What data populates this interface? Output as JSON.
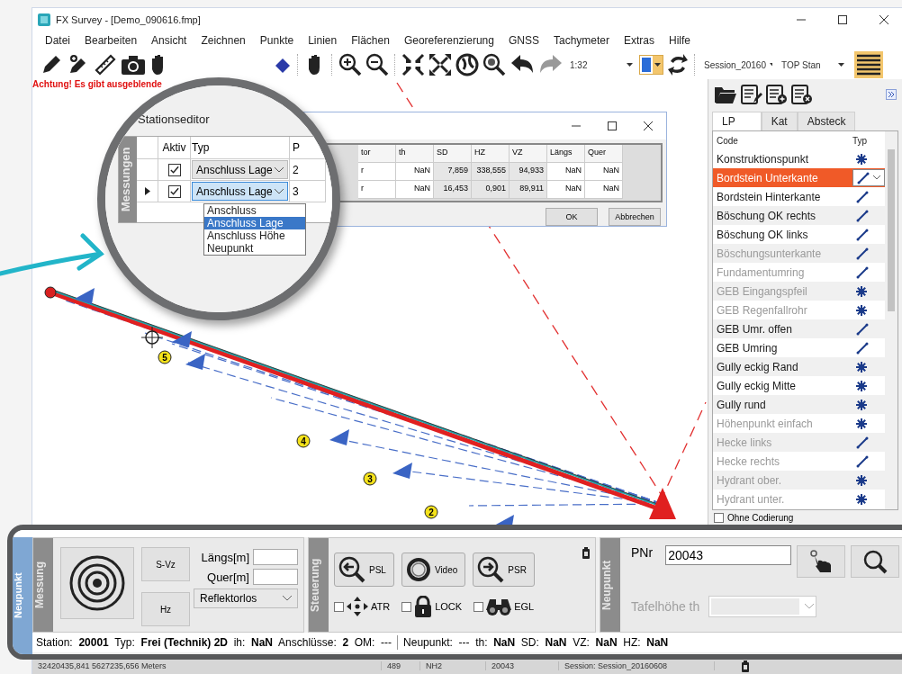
{
  "window": {
    "title": "FX Survey - [Demo_090616.fmp]"
  },
  "menu": [
    "Datei",
    "Bearbeiten",
    "Ansicht",
    "Zeichnen",
    "Punkte",
    "Linien",
    "Flächen",
    "Georeferenzierung",
    "GNSS",
    "Tachymeter",
    "Extras",
    "Hilfe"
  ],
  "toolbar": {
    "scale": "1:32",
    "session": "Session_20160",
    "instrument": "TOP Stan"
  },
  "warning": "Achtung! Es gibt ausgeblende",
  "map": {
    "markers": [
      "5",
      "4",
      "3",
      "2"
    ]
  },
  "magnifier": {
    "title": "Stationseditor",
    "side_label": "Messungen",
    "columns": [
      "Aktiv",
      "Typ",
      "P"
    ],
    "rows": [
      {
        "current": false,
        "checked": true,
        "type": "Anschluss Lage",
        "number": "2"
      },
      {
        "current": true,
        "checked": true,
        "type": "Anschluss Lage",
        "number": "3"
      }
    ],
    "options": [
      {
        "label": "Anschluss",
        "selected": false
      },
      {
        "label": "Anschluss Lage",
        "selected": true
      },
      {
        "label": "Anschluss Höhe",
        "selected": false
      },
      {
        "label": "Neupunkt",
        "selected": false
      }
    ]
  },
  "dialog": {
    "columns": [
      "tor",
      "th",
      "SD",
      "HZ",
      "VZ",
      "Längs",
      "Quer"
    ],
    "rows": [
      [
        "r",
        "NaN",
        "7,859",
        "338,555",
        "94,933",
        "NaN",
        "NaN"
      ],
      [
        "r",
        "NaN",
        "16,453",
        "0,901",
        "89,911",
        "NaN",
        "NaN"
      ]
    ],
    "buttons": [
      "OK",
      "Abbrechen"
    ]
  },
  "sidebar": {
    "tabs": [
      {
        "label": "LP",
        "selected": true
      },
      {
        "label": "Kat",
        "selected": false
      },
      {
        "label": "Absteck",
        "selected": false
      }
    ],
    "columns": [
      "Code",
      "Typ"
    ],
    "rows": [
      {
        "name": "Konstruktionspunkt",
        "kind": "point",
        "selected": false,
        "disabled": false
      },
      {
        "name": "Bordstein Unterkante",
        "kind": "line",
        "selected": true,
        "disabled": false
      },
      {
        "name": "Bordstein Hinterkante",
        "kind": "line",
        "selected": false,
        "disabled": false
      },
      {
        "name": "Böschung OK rechts",
        "kind": "line",
        "selected": false,
        "disabled": false
      },
      {
        "name": "Böschung OK links",
        "kind": "line",
        "selected": false,
        "disabled": false
      },
      {
        "name": "Böschungsunterkante",
        "kind": "line",
        "selected": false,
        "disabled": true
      },
      {
        "name": "Fundamentumring",
        "kind": "line",
        "selected": false,
        "disabled": true
      },
      {
        "name": "GEB Eingangspfeil",
        "kind": "point",
        "selected": false,
        "disabled": true
      },
      {
        "name": "GEB Regenfallrohr",
        "kind": "point",
        "selected": false,
        "disabled": true
      },
      {
        "name": "GEB Umr. offen",
        "kind": "line",
        "selected": false,
        "disabled": false
      },
      {
        "name": "GEB Umring",
        "kind": "line",
        "selected": false,
        "disabled": false
      },
      {
        "name": "Gully eckig Rand",
        "kind": "point",
        "selected": false,
        "disabled": false
      },
      {
        "name": "Gully eckig Mitte",
        "kind": "point",
        "selected": false,
        "disabled": false
      },
      {
        "name": "Gully rund",
        "kind": "point",
        "selected": false,
        "disabled": false
      },
      {
        "name": "Höhenpunkt einfach",
        "kind": "point",
        "selected": false,
        "disabled": true
      },
      {
        "name": "Hecke links",
        "kind": "line",
        "selected": false,
        "disabled": true
      },
      {
        "name": "Hecke rechts",
        "kind": "line",
        "selected": false,
        "disabled": true
      },
      {
        "name": "Hydrant ober.",
        "kind": "point",
        "selected": false,
        "disabled": true
      },
      {
        "name": "Hydrant unter.",
        "kind": "point",
        "selected": false,
        "disabled": true
      }
    ],
    "footer": {
      "label": "Ohne Codierung",
      "checked": false
    }
  },
  "panel": {
    "tab": "Neupunkt",
    "messung": {
      "label": "Messung",
      "buttons": [
        "S-Vz",
        "Hz"
      ],
      "fields": [
        {
          "label": "Längs[m]"
        },
        {
          "label": "Quer[m]"
        }
      ],
      "mode": "Reflektorlos"
    },
    "steuerung": {
      "label": "Steuerung",
      "buttons": [
        "PSL",
        "Video",
        "PSR"
      ],
      "toggles": [
        {
          "label": "ATR",
          "checked": false
        },
        {
          "label": "LOCK",
          "checked": false
        },
        {
          "label": "EGL",
          "checked": false
        }
      ]
    },
    "neupunkt": {
      "label": "Neupunkt",
      "pnr_label": "PNr",
      "pnr": "20043",
      "height_label": "Tafelhöhe th",
      "height_disabled": true
    },
    "info": [
      "Station:  **20001**  Typ:  **Frei (Technik) 2D**  ih:  **NaN**  Anschlüsse:  **2**  OM:  ---",
      "Neupunkt:  ---  th:  **NaN**  SD:  **NaN**  VZ:  **NaN**  HZ:  **NaN**"
    ]
  },
  "status_bar": [
    "32420435,841 5627235,656 Meters",
    "489",
    "NH2",
    "20043",
    "Session: Session_20160608"
  ]
}
